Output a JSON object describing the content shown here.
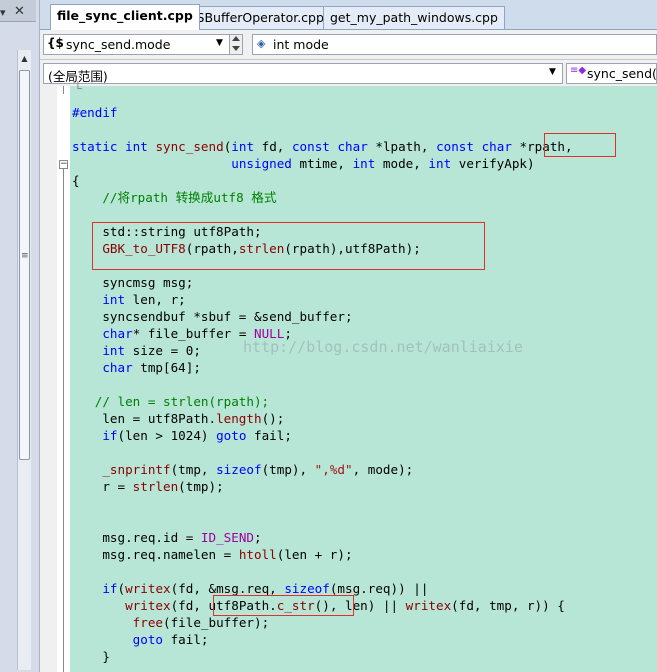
{
  "tabs": [
    {
      "label": "file_sync_client.cpp",
      "active": true
    },
    {
      "label": "IOSBufferOperator.cpp",
      "active": false
    },
    {
      "label": "get_my_path_windows.cpp",
      "active": false
    }
  ],
  "left_panel": {
    "close_glyph": "✕",
    "pin_glyph": "▾",
    "scroll_up_glyph": "▲",
    "grip_glyph": "≡"
  },
  "nav": {
    "class_combo": {
      "icon": "{$",
      "value": "sync_send.mode",
      "arrow": "▼"
    },
    "member_combo": {
      "icon": "◈",
      "value": "int mode"
    },
    "scope_combo": {
      "value": "(全局范围)",
      "arrow": "▼"
    },
    "function_combo": {
      "icon": "≡◆",
      "value": "sync_send(in"
    }
  },
  "code_lines": [
    {
      "text": "#endif"
    },
    {
      "text": ""
    },
    {
      "text": "static int sync_send(int fd, const char *lpath, const char *rpath,"
    },
    {
      "text": "                     unsigned mtime, int mode, int verifyApk)"
    },
    {
      "text": "{"
    },
    {
      "text": "    //将rpath 转换成utf8 格式"
    },
    {
      "text": ""
    },
    {
      "text": "    std::string utf8Path;"
    },
    {
      "text": "    GBK_to_UTF8(rpath,strlen(rpath),utf8Path);"
    },
    {
      "text": ""
    },
    {
      "text": "    syncmsg msg;"
    },
    {
      "text": "    int len, r;"
    },
    {
      "text": "    syncsendbuf *sbuf = &send_buffer;"
    },
    {
      "text": "    char* file_buffer = NULL;"
    },
    {
      "text": "    int size = 0;"
    },
    {
      "text": "    char tmp[64];"
    },
    {
      "text": ""
    },
    {
      "text": "   // len = strlen(rpath);"
    },
    {
      "text": "    len = utf8Path.length();"
    },
    {
      "text": "    if(len > 1024) goto fail;"
    },
    {
      "text": ""
    },
    {
      "text": "    _snprintf(tmp, sizeof(tmp), \",%d\", mode);"
    },
    {
      "text": "    r = strlen(tmp);"
    },
    {
      "text": ""
    },
    {
      "text": ""
    },
    {
      "text": "    msg.req.id = ID_SEND;"
    },
    {
      "text": "    msg.req.namelen = htoll(len + r);"
    },
    {
      "text": ""
    },
    {
      "text": "    if(writex(fd, &msg.req, sizeof(msg.req)) ||"
    },
    {
      "text": "       writex(fd, utf8Path.c_str(), len) || writex(fd, tmp, r)) {"
    },
    {
      "text": "        free(file_buffer);"
    },
    {
      "text": "        goto fail;"
    },
    {
      "text": "    }"
    }
  ],
  "watermark": "http://blog.csdn.net/wanliaixie",
  "colors": {
    "code_bg": "#b7e6d7",
    "keyword": "#0000ff",
    "comment": "#008000",
    "highlight_box": "#e0302a"
  }
}
